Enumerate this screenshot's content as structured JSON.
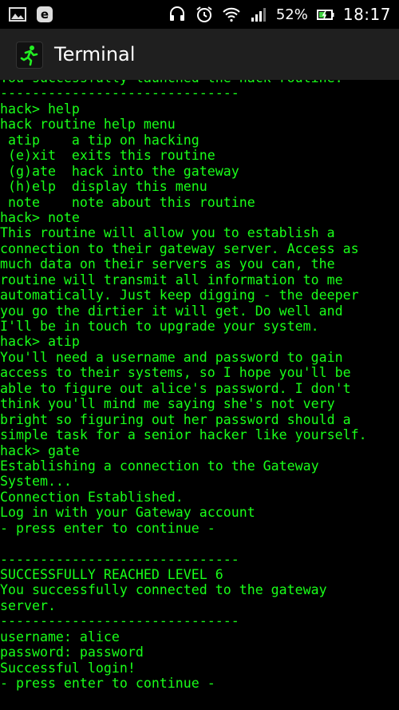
{
  "status_bar": {
    "battery_percent": "52%",
    "time": "18:17",
    "icons": [
      "gallery-icon",
      "e-icon",
      "headset-icon",
      "alarm-icon",
      "wifi-icon",
      "signal-icon",
      "battery-icon"
    ]
  },
  "action_bar": {
    "title": "Terminal",
    "icon": "running-man-icon",
    "accent": "#22ee22"
  },
  "terminal": {
    "color": "#19ff19",
    "lines": [
      "You successfully launched the hack routine.",
      "------------------------------",
      "hack> help",
      "hack routine help menu",
      " atip    a tip on hacking",
      " (e)xit  exits this routine",
      " (g)ate  hack into the gateway",
      " (h)elp  display this menu",
      " note    note about this routine",
      "hack> note",
      "This routine will allow you to establish a",
      "connection to their gateway server. Access as",
      "much data on their servers as you can, the",
      "routine will transmit all information to me",
      "automatically. Just keep digging - the deeper",
      "you go the dirtier it will get. Do well and",
      "I'll be in touch to upgrade your system.",
      "hack> atip",
      "You'll need a username and password to gain",
      "access to their systems, so I hope you'll be",
      "able to figure out alice's password. I don't",
      "think you'll mind me saying she's not very",
      "bright so figuring out her password should a",
      "simple task for a senior hacker like yourself.",
      "hack> gate",
      "Establishing a connection to the Gateway",
      "System...",
      "Connection Established.",
      "Log in with your Gateway account",
      "- press enter to continue -",
      "",
      "------------------------------",
      "SUCCESSFULLY REACHED LEVEL 6",
      "You successfully connected to the gateway",
      "server.",
      "------------------------------",
      "username: alice",
      "password: password",
      "Successful login!",
      "- press enter to continue -"
    ]
  }
}
